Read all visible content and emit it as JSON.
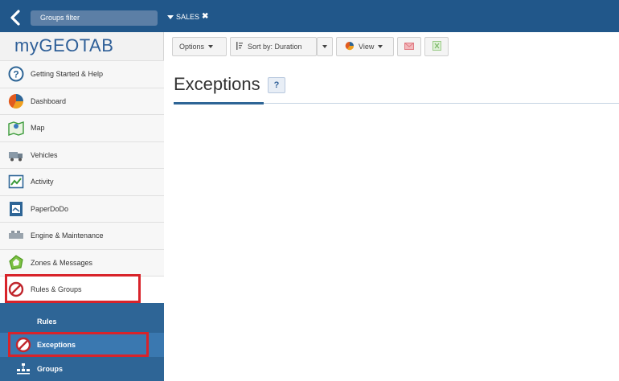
{
  "topbar": {
    "groups_filter": "Groups filter",
    "active_filter": "SALES"
  },
  "brand": {
    "my": "my",
    "name": "GEOTAB"
  },
  "sidebar": {
    "items": [
      {
        "label": "Getting Started & Help",
        "icon": "help-circle-icon"
      },
      {
        "label": "Dashboard",
        "icon": "pie-chart-icon"
      },
      {
        "label": "Map",
        "icon": "map-icon"
      },
      {
        "label": "Vehicles",
        "icon": "truck-icon"
      },
      {
        "label": "Activity",
        "icon": "activity-chart-icon"
      },
      {
        "label": "PaperDoDo",
        "icon": "document-icon"
      },
      {
        "label": "Engine & Maintenance",
        "icon": "engine-icon"
      },
      {
        "label": "Zones & Messages",
        "icon": "zone-icon"
      },
      {
        "label": "Rules & Groups",
        "icon": "prohibited-icon"
      }
    ],
    "subitems": [
      {
        "label": "Rules"
      },
      {
        "label": "Exceptions"
      },
      {
        "label": "Groups"
      }
    ]
  },
  "toolbar": {
    "options_label": "Options",
    "sort_label": "Sort by: Duration",
    "view_label": "View"
  },
  "main": {
    "title": "Exceptions",
    "help_label": "?"
  },
  "colors": {
    "topbar": "#21578a",
    "subnav": "#2e6596",
    "highlight": "#d8232a"
  }
}
